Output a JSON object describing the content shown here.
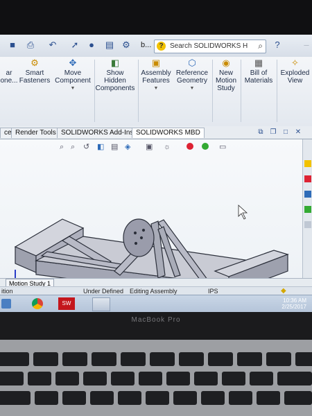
{
  "quick_access": {
    "title_fragment": "b...",
    "search_placeholder": "Search SOLIDWORKS H"
  },
  "ribbon": {
    "buttons": [
      {
        "label": "ar\none..."
      },
      {
        "label": "Smart\nFasteners"
      },
      {
        "label": "Move\nComponent"
      },
      {
        "label": "Show\nHidden\nComponents"
      },
      {
        "label": "Assembly\nFeatures"
      },
      {
        "label": "Reference\nGeometry"
      },
      {
        "label": "New\nMotion\nStudy"
      },
      {
        "label": "Bill of\nMaterials"
      },
      {
        "label": "Exploded\nView"
      }
    ]
  },
  "tabs": [
    "ce",
    "Render Tools",
    "SOLIDWORKS Add-Ins",
    "SOLIDWORKS MBD"
  ],
  "bottom_tab": "Motion Study 1",
  "status": {
    "left": "ition",
    "state": "Under Defined",
    "mode": "Editing Assembly",
    "units": "IPS"
  },
  "taskbar": {
    "time": "10:36 AM",
    "date": "2/25/2017"
  },
  "laptop_brand": "MacBook Pro",
  "colors": {
    "accent": "#2b4f8f",
    "model": "#aeb0bd"
  }
}
